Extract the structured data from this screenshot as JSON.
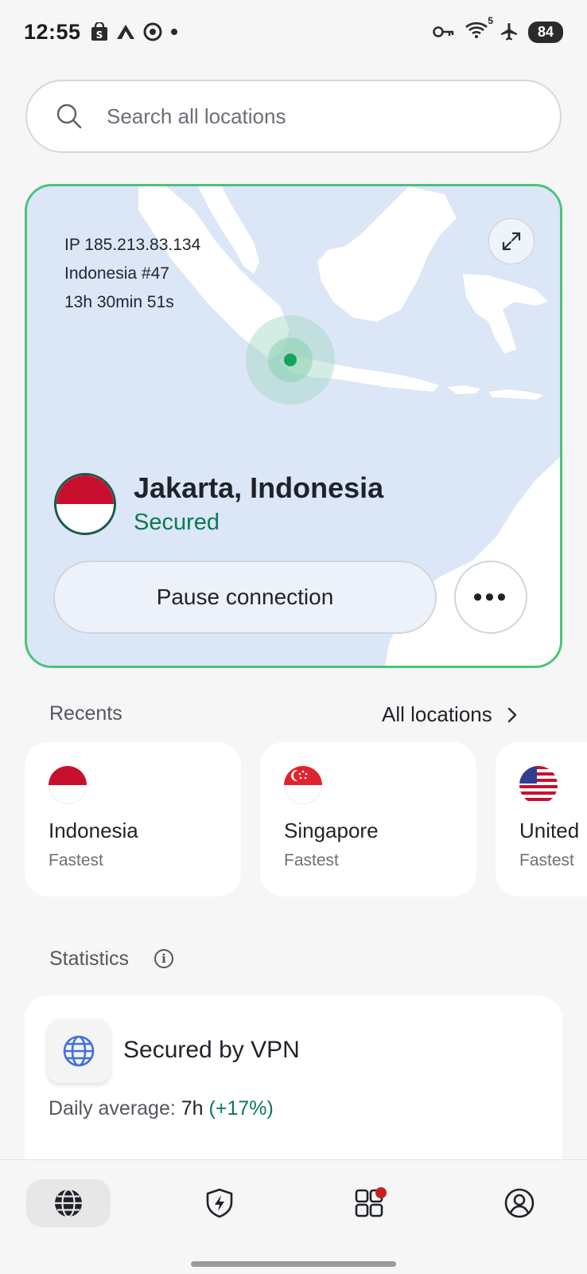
{
  "status_bar": {
    "time": "12:55",
    "left_icons": [
      "shop-icon",
      "nord-icon",
      "target-icon",
      "dot-icon"
    ],
    "right_icons": [
      "vpn-key-icon",
      "wifi-icon",
      "airplane-icon"
    ],
    "wifi_label": "5",
    "battery": "84"
  },
  "search": {
    "placeholder": "Search all locations"
  },
  "connection": {
    "ip": "IP 185.213.83.134",
    "server": "Indonesia #47",
    "duration": "13h 30min 51s",
    "location": "Jakarta, Indonesia",
    "status": "Secured",
    "pause_label": "Pause connection",
    "more_label": "•••",
    "expand_icon": "expand-icon"
  },
  "recents": {
    "title": "Recents",
    "all_locations": "All locations",
    "items": [
      {
        "name": "Indonesia",
        "sub": "Fastest",
        "flag": "indonesia"
      },
      {
        "name": "Singapore",
        "sub": "Fastest",
        "flag": "singapore"
      },
      {
        "name": "United",
        "sub": "Fastest",
        "flag": "usa"
      }
    ]
  },
  "statistics": {
    "title": "Statistics",
    "card_title": "Secured by VPN",
    "daily_label": "Daily average:",
    "daily_value": "7h",
    "daily_delta": "(+17%)"
  },
  "nav": {
    "items": [
      "globe-icon",
      "shield-bolt-icon",
      "apps-icon",
      "profile-icon"
    ],
    "active": "globe-icon"
  },
  "colors": {
    "accent_green": "#4cc27a",
    "secured_green": "#0a7a52",
    "map_sea": "#dbe6f6",
    "flag_red": "#c8102e",
    "badge_red": "#c62121"
  }
}
